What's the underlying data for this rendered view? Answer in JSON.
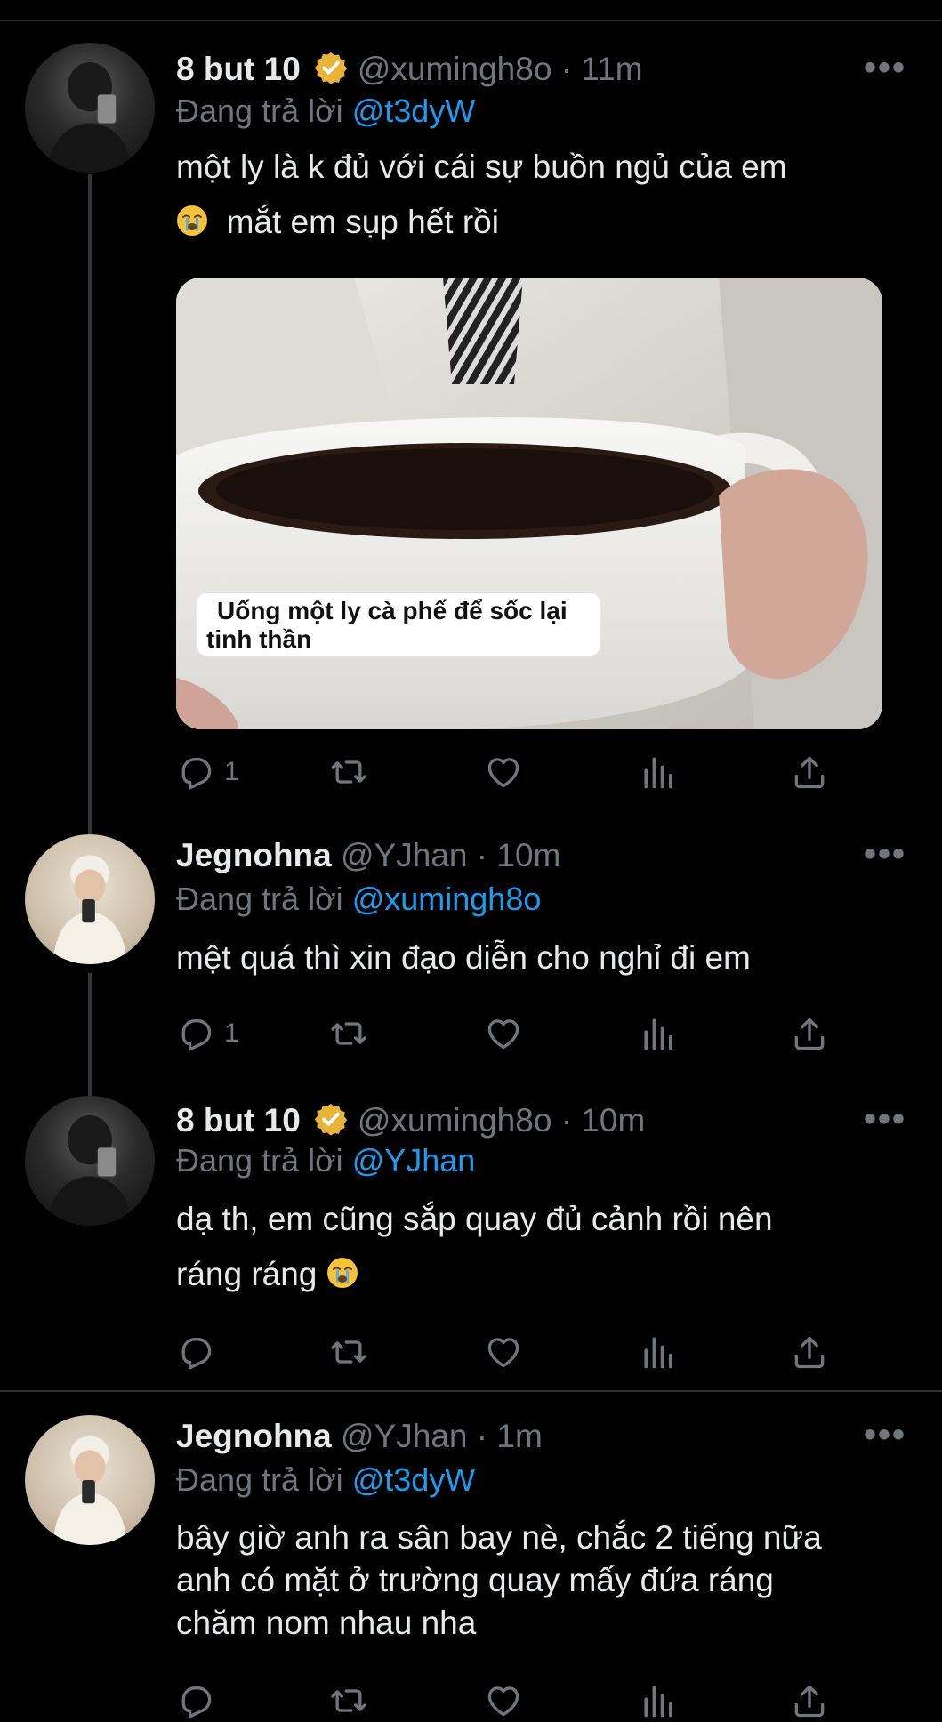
{
  "tweets": [
    {
      "name": "8 but 10",
      "verified": true,
      "handle": "@xumingh8o",
      "time": "11m",
      "replying_prefix": "Đang trả lời",
      "replying_to": "@t3dyW",
      "text_line1": "một ly là k đủ với cái sự buồn ngủ của em",
      "text_line2": "mắt em sụp hết rồi",
      "media_caption_line1": "Uống một ly cà phế để sốc lại",
      "media_caption_line2": "tinh thần",
      "reply_count": "1"
    },
    {
      "name": "Jegnohna",
      "handle": "@YJhan",
      "time": "10m",
      "replying_prefix": "Đang trả lời",
      "replying_to": "@xumingh8o",
      "text_line1": "mệt quá thì xin đạo diễn cho nghỉ đi em",
      "reply_count": "1"
    },
    {
      "name": "8 but 10",
      "verified": true,
      "handle": "@xumingh8o",
      "time": "10m",
      "replying_prefix": "Đang trả lời",
      "replying_to": "@YJhan",
      "text_line1": "dạ th, em cũng sắp quay đủ cảnh rồi nên",
      "text_line2": "ráng ráng"
    },
    {
      "name": "Jegnohna",
      "handle": "@YJhan",
      "time": "1m",
      "replying_prefix": "Đang trả lời",
      "replying_to": "@t3dyW",
      "text_line1": "bây giờ anh ra sân bay nè, chắc 2 tiếng nữa",
      "text_line2": "anh có mặt ở trường quay mấy đứa ráng",
      "text_line3": "chăm nom nhau nha"
    }
  ],
  "more_label": "•••",
  "dot": "·",
  "icons": [
    "reply-icon",
    "retweet-icon",
    "like-icon",
    "analytics-icon",
    "share-icon",
    "verified-badge-icon",
    "more-icon",
    "loudly-crying-emoji"
  ],
  "colors": {
    "background": "#000000",
    "text": "#e7e9ea",
    "muted": "#71767b",
    "accent": "#1d9bf0",
    "verified": "#e8b339",
    "divider": "#2f3336"
  }
}
